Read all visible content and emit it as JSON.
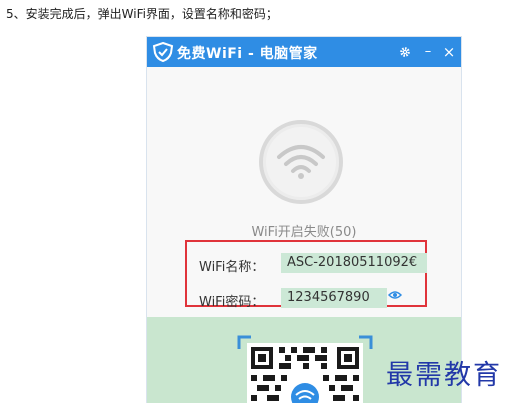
{
  "instruction": "5、安装完成后，弹出WiFi界面，设置名称和密码；",
  "window": {
    "title": "免费WiFi - 电脑管家",
    "controls": {
      "settings_icon": "gear-icon",
      "minimize_symbol": "–",
      "close_symbol": "×"
    },
    "accent_color": "#2f8de4"
  },
  "status_text": "WiFi开启失败(50)",
  "wifi_name": {
    "label": "WiFi名称：",
    "value": "ASC-20180511092€"
  },
  "wifi_password": {
    "label": "WiFi密码：",
    "value": "1234567890",
    "show_password_icon": "eye-icon"
  },
  "highlight_color": "#e0343b",
  "watermark": "最需教育"
}
